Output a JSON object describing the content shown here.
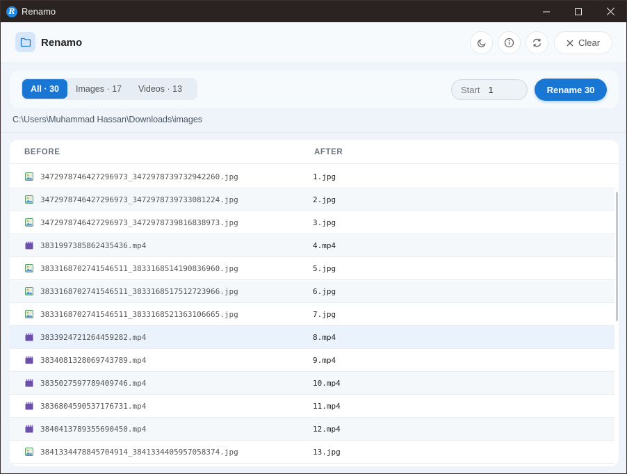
{
  "window": {
    "title": "Renamo",
    "logo_letter": "R"
  },
  "header": {
    "app_name": "Renamo",
    "clear_label": "Clear"
  },
  "filters": {
    "tabs": [
      {
        "label": "All · 30",
        "active": true
      },
      {
        "label": "Images · 17",
        "active": false
      },
      {
        "label": "Videos · 13",
        "active": false
      }
    ],
    "start_label": "Start",
    "start_value": "1",
    "rename_label": "Rename 30"
  },
  "path": "C:\\Users\\Muhammad Hassan\\Downloads\\images",
  "table": {
    "columns": [
      "BEFORE",
      "AFTER"
    ],
    "rows": [
      {
        "type": "image",
        "before": "3472978746427296973_3472978739732942260.jpg",
        "after": "1.jpg"
      },
      {
        "type": "image",
        "before": "3472978746427296973_3472978739733081224.jpg",
        "after": "2.jpg"
      },
      {
        "type": "image",
        "before": "3472978746427296973_3472978739816838973.jpg",
        "after": "3.jpg"
      },
      {
        "type": "video",
        "before": "3831997385862435436.mp4",
        "after": "4.mp4"
      },
      {
        "type": "image",
        "before": "3833168702741546511_3833168514190836960.jpg",
        "after": "5.jpg"
      },
      {
        "type": "image",
        "before": "3833168702741546511_3833168517512723966.jpg",
        "after": "6.jpg"
      },
      {
        "type": "image",
        "before": "3833168702741546511_3833168521363106665.jpg",
        "after": "7.jpg"
      },
      {
        "type": "video",
        "before": "3833924721264459282.mp4",
        "after": "8.mp4"
      },
      {
        "type": "video",
        "before": "3834081328069743789.mp4",
        "after": "9.mp4"
      },
      {
        "type": "video",
        "before": "3835027597789409746.mp4",
        "after": "10.mp4"
      },
      {
        "type": "video",
        "before": "3836804590537176731.mp4",
        "after": "11.mp4"
      },
      {
        "type": "video",
        "before": "3840413789355690450.mp4",
        "after": "12.mp4"
      },
      {
        "type": "image",
        "before": "3841334478845704914_3841334405957058374.jpg",
        "after": "13.jpg"
      }
    ]
  },
  "icons": {
    "image_icon": "image-file-icon",
    "video_icon": "video-file-icon"
  },
  "colors": {
    "accent": "#1976d2",
    "titlebar": "#2b2222",
    "background": "#eef4fa"
  }
}
